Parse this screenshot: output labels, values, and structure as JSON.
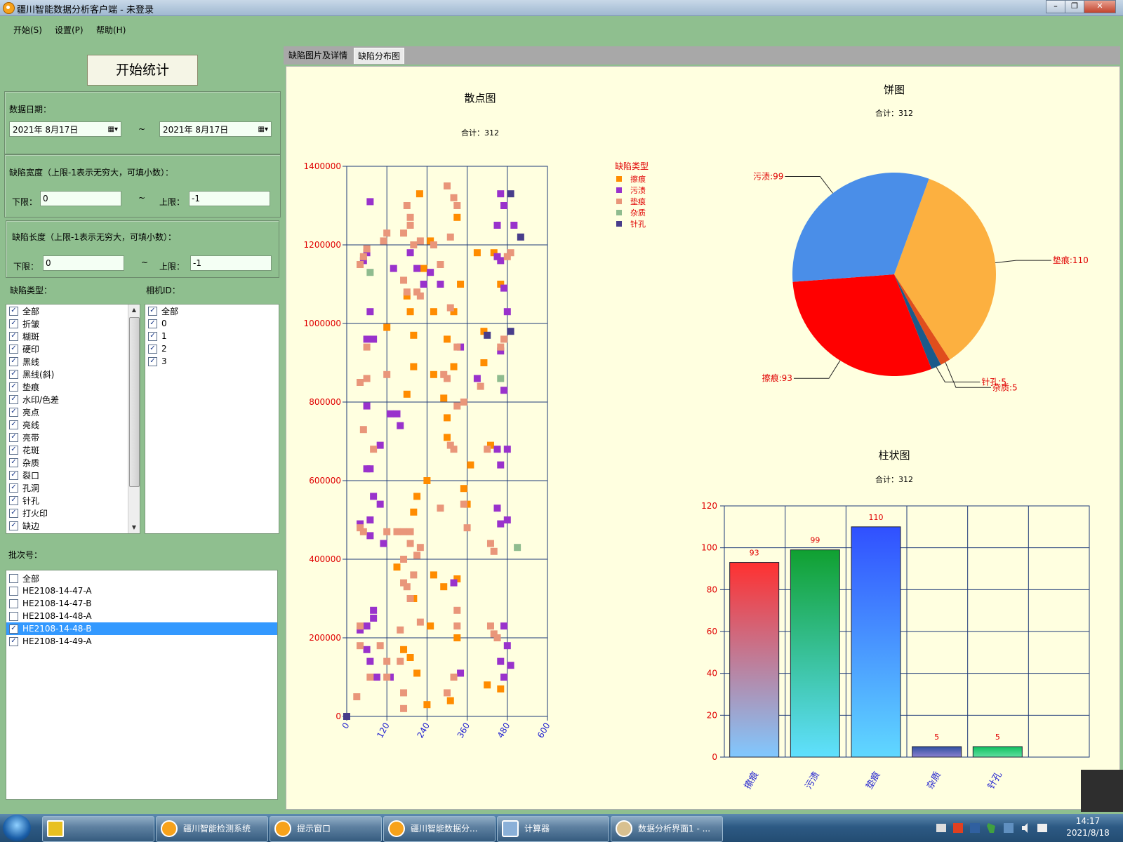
{
  "window": {
    "title": "疆川智能数据分析客户端 - 未登录"
  },
  "menu": [
    "开始(S)",
    "设置(P)",
    "帮助(H)"
  ],
  "left": {
    "start_button": "开始统计",
    "date": {
      "label": "数据日期：",
      "from": "2021年  8月17日",
      "to": "2021年  8月17日",
      "sep": "~"
    },
    "width": {
      "label": "缺陷宽度（上限-1表示无穷大，可填小数）：",
      "lower_label": "下限：",
      "lower": "0",
      "upper_label": "上限：",
      "upper": "-1",
      "sep": "~"
    },
    "length": {
      "label": "缺陷长度（上限-1表示无穷大，可填小数）：",
      "lower_label": "下限：",
      "lower": "0",
      "upper_label": "上限：",
      "upper": "-1",
      "sep": "~"
    },
    "defect_type_label": "缺陷类型：",
    "defect_types": [
      "全部",
      "折皱",
      "糊斑",
      "硬印",
      "黑线",
      "黑线(斜)",
      "垫痕",
      "水印/色差",
      "亮点",
      "亮线",
      "亮带",
      "花斑",
      "杂质",
      "裂口",
      "孔洞",
      "针孔",
      "打火印",
      "缺边"
    ],
    "camera_label": "相机ID：",
    "cameras": [
      "全部",
      "0",
      "1",
      "2",
      "3"
    ],
    "batch_label": "批次号：",
    "batches": [
      {
        "name": "全部",
        "checked": false,
        "selected": false
      },
      {
        "name": "HE2108-14-47-A",
        "checked": false,
        "selected": false
      },
      {
        "name": "HE2108-14-47-B",
        "checked": false,
        "selected": false
      },
      {
        "name": "HE2108-14-48-A",
        "checked": false,
        "selected": false
      },
      {
        "name": "HE2108-14-48-B",
        "checked": true,
        "selected": true
      },
      {
        "name": "HE2108-14-49-A",
        "checked": true,
        "selected": false
      }
    ]
  },
  "tabs": [
    "缺陷图片及详情",
    "缺陷分布图"
  ],
  "colors": {
    "scratch": "#ff8c00",
    "stain": "#9932cc",
    "pad": "#e9967a",
    "impurity": "#8fbc8f",
    "pinhole": "#483d8b"
  },
  "chart_data": [
    {
      "type": "scatter",
      "title": "散点图",
      "subtitle": "合计：312",
      "legend_title": "缺陷类型",
      "legend_position": "top-right",
      "xlim": [
        0,
        600
      ],
      "ylim": [
        0,
        1400000
      ],
      "x_ticks": [
        "0",
        "120",
        "240",
        "360",
        "480",
        "600"
      ],
      "y_ticks": [
        "0",
        "200000",
        "400000",
        "600000",
        "800000",
        "1000000",
        "1200000",
        "1400000"
      ],
      "grid": true,
      "series": [
        {
          "name": "擦痕",
          "color": "#ff8c00",
          "points": [
            [
              218,
              1330000
            ],
            [
              180,
              1070000
            ],
            [
              250,
              1210000
            ],
            [
              320,
              1030000
            ],
            [
              300,
              960000
            ],
            [
              200,
              970000
            ],
            [
              410,
              900000
            ],
            [
              430,
              690000
            ],
            [
              240,
              600000
            ],
            [
              210,
              560000
            ],
            [
              200,
              520000
            ],
            [
              150,
              380000
            ],
            [
              260,
              360000
            ],
            [
              330,
              350000
            ],
            [
              290,
              330000
            ],
            [
              200,
              300000
            ],
            [
              250,
              230000
            ],
            [
              330,
              200000
            ],
            [
              190,
              150000
            ],
            [
              210,
              110000
            ],
            [
              170,
              170000
            ],
            [
              240,
              30000
            ],
            [
              310,
              40000
            ],
            [
              460,
              70000
            ],
            [
              420,
              80000
            ],
            [
              390,
              1180000
            ],
            [
              440,
              1180000
            ],
            [
              460,
              1100000
            ],
            [
              300,
              760000
            ],
            [
              370,
              640000
            ],
            [
              350,
              580000
            ],
            [
              360,
              540000
            ],
            [
              290,
              810000
            ],
            [
              300,
              710000
            ],
            [
              180,
              820000
            ],
            [
              200,
              890000
            ],
            [
              260,
              870000
            ],
            [
              320,
              890000
            ],
            [
              410,
              980000
            ],
            [
              230,
              1140000
            ],
            [
              340,
              1100000
            ],
            [
              190,
              1030000
            ],
            [
              260,
              1030000
            ],
            [
              120,
              990000
            ],
            [
              330,
              1270000
            ]
          ]
        },
        {
          "name": "污渍",
          "color": "#9932cc",
          "points": [
            [
              70,
              1310000
            ],
            [
              60,
              1180000
            ],
            [
              50,
              1160000
            ],
            [
              140,
              1140000
            ],
            [
              210,
              1140000
            ],
            [
              230,
              1100000
            ],
            [
              280,
              1100000
            ],
            [
              70,
              1030000
            ],
            [
              60,
              960000
            ],
            [
              80,
              960000
            ],
            [
              340,
              940000
            ],
            [
              390,
              860000
            ],
            [
              460,
              930000
            ],
            [
              470,
              830000
            ],
            [
              60,
              790000
            ],
            [
              130,
              770000
            ],
            [
              150,
              770000
            ],
            [
              160,
              740000
            ],
            [
              100,
              690000
            ],
            [
              60,
              630000
            ],
            [
              70,
              630000
            ],
            [
              80,
              560000
            ],
            [
              100,
              540000
            ],
            [
              70,
              500000
            ],
            [
              40,
              490000
            ],
            [
              70,
              460000
            ],
            [
              110,
              440000
            ],
            [
              320,
              340000
            ],
            [
              80,
              270000
            ],
            [
              80,
              250000
            ],
            [
              60,
              230000
            ],
            [
              40,
              220000
            ],
            [
              60,
              170000
            ],
            [
              70,
              140000
            ],
            [
              90,
              100000
            ],
            [
              130,
              100000
            ],
            [
              340,
              110000
            ],
            [
              470,
              100000
            ],
            [
              490,
              130000
            ],
            [
              460,
              140000
            ],
            [
              480,
              180000
            ],
            [
              470,
              230000
            ],
            [
              460,
              490000
            ],
            [
              480,
              500000
            ],
            [
              450,
              530000
            ],
            [
              460,
              640000
            ],
            [
              480,
              680000
            ],
            [
              450,
              680000
            ],
            [
              480,
              1030000
            ],
            [
              470,
              1090000
            ],
            [
              460,
              1160000
            ],
            [
              450,
              1170000
            ],
            [
              470,
              1300000
            ],
            [
              460,
              1330000
            ],
            [
              500,
              1250000
            ],
            [
              450,
              1250000
            ],
            [
              250,
              1130000
            ],
            [
              190,
              1180000
            ]
          ]
        },
        {
          "name": "垫痕",
          "color": "#e9967a",
          "points": [
            [
              50,
              1170000
            ],
            [
              60,
              1190000
            ],
            [
              40,
              1150000
            ],
            [
              110,
              1210000
            ],
            [
              120,
              1230000
            ],
            [
              170,
              1230000
            ],
            [
              200,
              1200000
            ],
            [
              220,
              1210000
            ],
            [
              260,
              1200000
            ],
            [
              310,
              1220000
            ],
            [
              330,
              1300000
            ],
            [
              320,
              1320000
            ],
            [
              300,
              1350000
            ],
            [
              180,
              1300000
            ],
            [
              190,
              1270000
            ],
            [
              190,
              1250000
            ],
            [
              170,
              1110000
            ],
            [
              180,
              1080000
            ],
            [
              210,
              1080000
            ],
            [
              220,
              1070000
            ],
            [
              280,
              1150000
            ],
            [
              310,
              1040000
            ],
            [
              60,
              940000
            ],
            [
              120,
              870000
            ],
            [
              40,
              850000
            ],
            [
              60,
              860000
            ],
            [
              50,
              730000
            ],
            [
              80,
              680000
            ],
            [
              290,
              870000
            ],
            [
              300,
              860000
            ],
            [
              320,
              680000
            ],
            [
              310,
              690000
            ],
            [
              330,
              790000
            ],
            [
              350,
              800000
            ],
            [
              330,
              940000
            ],
            [
              400,
              840000
            ],
            [
              420,
              680000
            ],
            [
              460,
              940000
            ],
            [
              470,
              960000
            ],
            [
              480,
              1170000
            ],
            [
              490,
              1180000
            ],
            [
              40,
              480000
            ],
            [
              50,
              470000
            ],
            [
              120,
              470000
            ],
            [
              170,
              470000
            ],
            [
              150,
              470000
            ],
            [
              190,
              440000
            ],
            [
              210,
              410000
            ],
            [
              220,
              430000
            ],
            [
              170,
              400000
            ],
            [
              170,
              340000
            ],
            [
              200,
              360000
            ],
            [
              180,
              330000
            ],
            [
              190,
              300000
            ],
            [
              40,
              230000
            ],
            [
              160,
              220000
            ],
            [
              220,
              240000
            ],
            [
              330,
              230000
            ],
            [
              330,
              270000
            ],
            [
              360,
              480000
            ],
            [
              350,
              540000
            ],
            [
              280,
              530000
            ],
            [
              190,
              470000
            ],
            [
              40,
              180000
            ],
            [
              100,
              180000
            ],
            [
              120,
              140000
            ],
            [
              160,
              140000
            ],
            [
              120,
              100000
            ],
            [
              30,
              50000
            ],
            [
              70,
              100000
            ],
            [
              170,
              60000
            ],
            [
              170,
              20000
            ],
            [
              300,
              60000
            ],
            [
              320,
              100000
            ],
            [
              430,
              230000
            ],
            [
              440,
              210000
            ],
            [
              450,
              200000
            ],
            [
              440,
              420000
            ],
            [
              430,
              440000
            ]
          ]
        },
        {
          "name": "杂质",
          "color": "#8fbc8f",
          "points": [
            [
              70,
              1130000
            ],
            [
              460,
              860000
            ],
            [
              510,
              430000
            ]
          ]
        },
        {
          "name": "针孔",
          "color": "#483d8b",
          "points": [
            [
              0,
              0
            ],
            [
              420,
              970000
            ],
            [
              490,
              980000
            ],
            [
              520,
              1220000
            ],
            [
              490,
              1330000
            ]
          ]
        }
      ]
    },
    {
      "type": "pie",
      "title": "饼图",
      "subtitle": "合计：312",
      "slices": [
        {
          "label": "垫痕",
          "value": 110,
          "color": "#fcb040",
          "text": "垫痕:110"
        },
        {
          "label": "杂质",
          "value": 5,
          "color": "#e04e1d",
          "text": "杂质:5"
        },
        {
          "label": "针孔",
          "value": 5,
          "color": "#1b5a8a",
          "text": "针孔:5"
        },
        {
          "label": "擦痕",
          "value": 93,
          "color": "#ff0000",
          "text": "擦痕:93"
        },
        {
          "label": "污渍",
          "value": 99,
          "color": "#4a8ee8",
          "text": "污渍:99"
        }
      ]
    },
    {
      "type": "bar",
      "title": "柱状图",
      "subtitle": "合计：312",
      "categories": [
        "擦痕",
        "污渍",
        "垫痕",
        "杂质",
        "针孔"
      ],
      "values": [
        93,
        99,
        110,
        5,
        5
      ],
      "ylim": [
        0,
        120
      ],
      "y_ticks": [
        "0",
        "20",
        "40",
        "60",
        "80",
        "100",
        "120"
      ],
      "grid": true
    }
  ],
  "taskbar": {
    "items": [
      "疆川智能检测系统",
      "提示窗口",
      "疆川智能数据分...",
      "计算器",
      "数据分析界面1 - ..."
    ],
    "time": "14:17",
    "date": "2021/8/18"
  }
}
